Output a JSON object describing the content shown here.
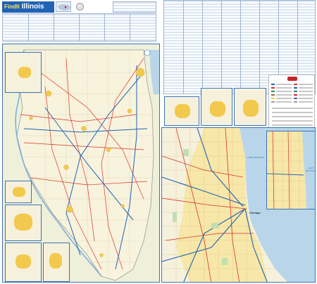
{
  "header": {
    "brand": "FindIt",
    "title": "Illinois"
  },
  "main_map": {
    "lake_label": "LAKE MICHIGAN",
    "city_label": "Chicago"
  },
  "chicago_inset": {
    "lake_label": "LAKE MICHIGAN"
  },
  "colors": {
    "land": "#f6f1dc",
    "water": "#b8d5ea",
    "border": "#3a73b7",
    "urban": "#f2c94c",
    "interstate": "#1f63b5",
    "highway": "#d9352b"
  },
  "icons": [
    "us-locator-map-icon",
    "state-seal-icon",
    "compass-rose-icon",
    "publisher-logo-icon"
  ]
}
